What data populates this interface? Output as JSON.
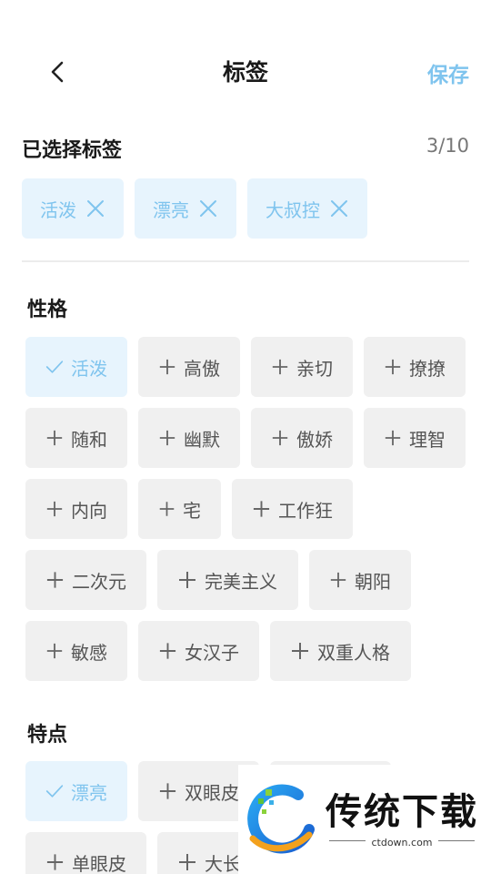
{
  "header": {
    "title": "标签",
    "save_label": "保存"
  },
  "selected": {
    "title": "已选择标签",
    "count": "3/10",
    "items": [
      {
        "label": "活泼"
      },
      {
        "label": "漂亮"
      },
      {
        "label": "大叔控"
      }
    ]
  },
  "personality": {
    "title": "性格",
    "rows": [
      [
        {
          "label": "活泼",
          "active": true
        },
        {
          "label": "高傲"
        },
        {
          "label": "亲切"
        },
        {
          "label": "撩撩"
        }
      ],
      [
        {
          "label": "随和"
        },
        {
          "label": "幽默"
        },
        {
          "label": "傲娇"
        },
        {
          "label": "理智"
        }
      ],
      [
        {
          "label": "内向"
        },
        {
          "label": "宅"
        },
        {
          "label": "工作狂"
        }
      ],
      [
        {
          "label": "二次元"
        },
        {
          "label": "完美主义"
        },
        {
          "label": "朝阳"
        }
      ],
      [
        {
          "label": "敏感"
        },
        {
          "label": "女汉子"
        },
        {
          "label": "双重人格"
        }
      ]
    ]
  },
  "features": {
    "title": "特点",
    "rows": [
      [
        {
          "label": "漂亮",
          "active": true
        },
        {
          "label": "双眼皮"
        },
        {
          "label": ""
        }
      ],
      [
        {
          "label": "单眼皮"
        },
        {
          "label": "大长"
        }
      ]
    ]
  },
  "watermark": {
    "name": "传统下载",
    "url": "ctdown.com"
  },
  "colors": {
    "accent": "#7fc4ee",
    "accent_bg": "#e7f4fd",
    "tag_bg": "#f0f0f0"
  }
}
